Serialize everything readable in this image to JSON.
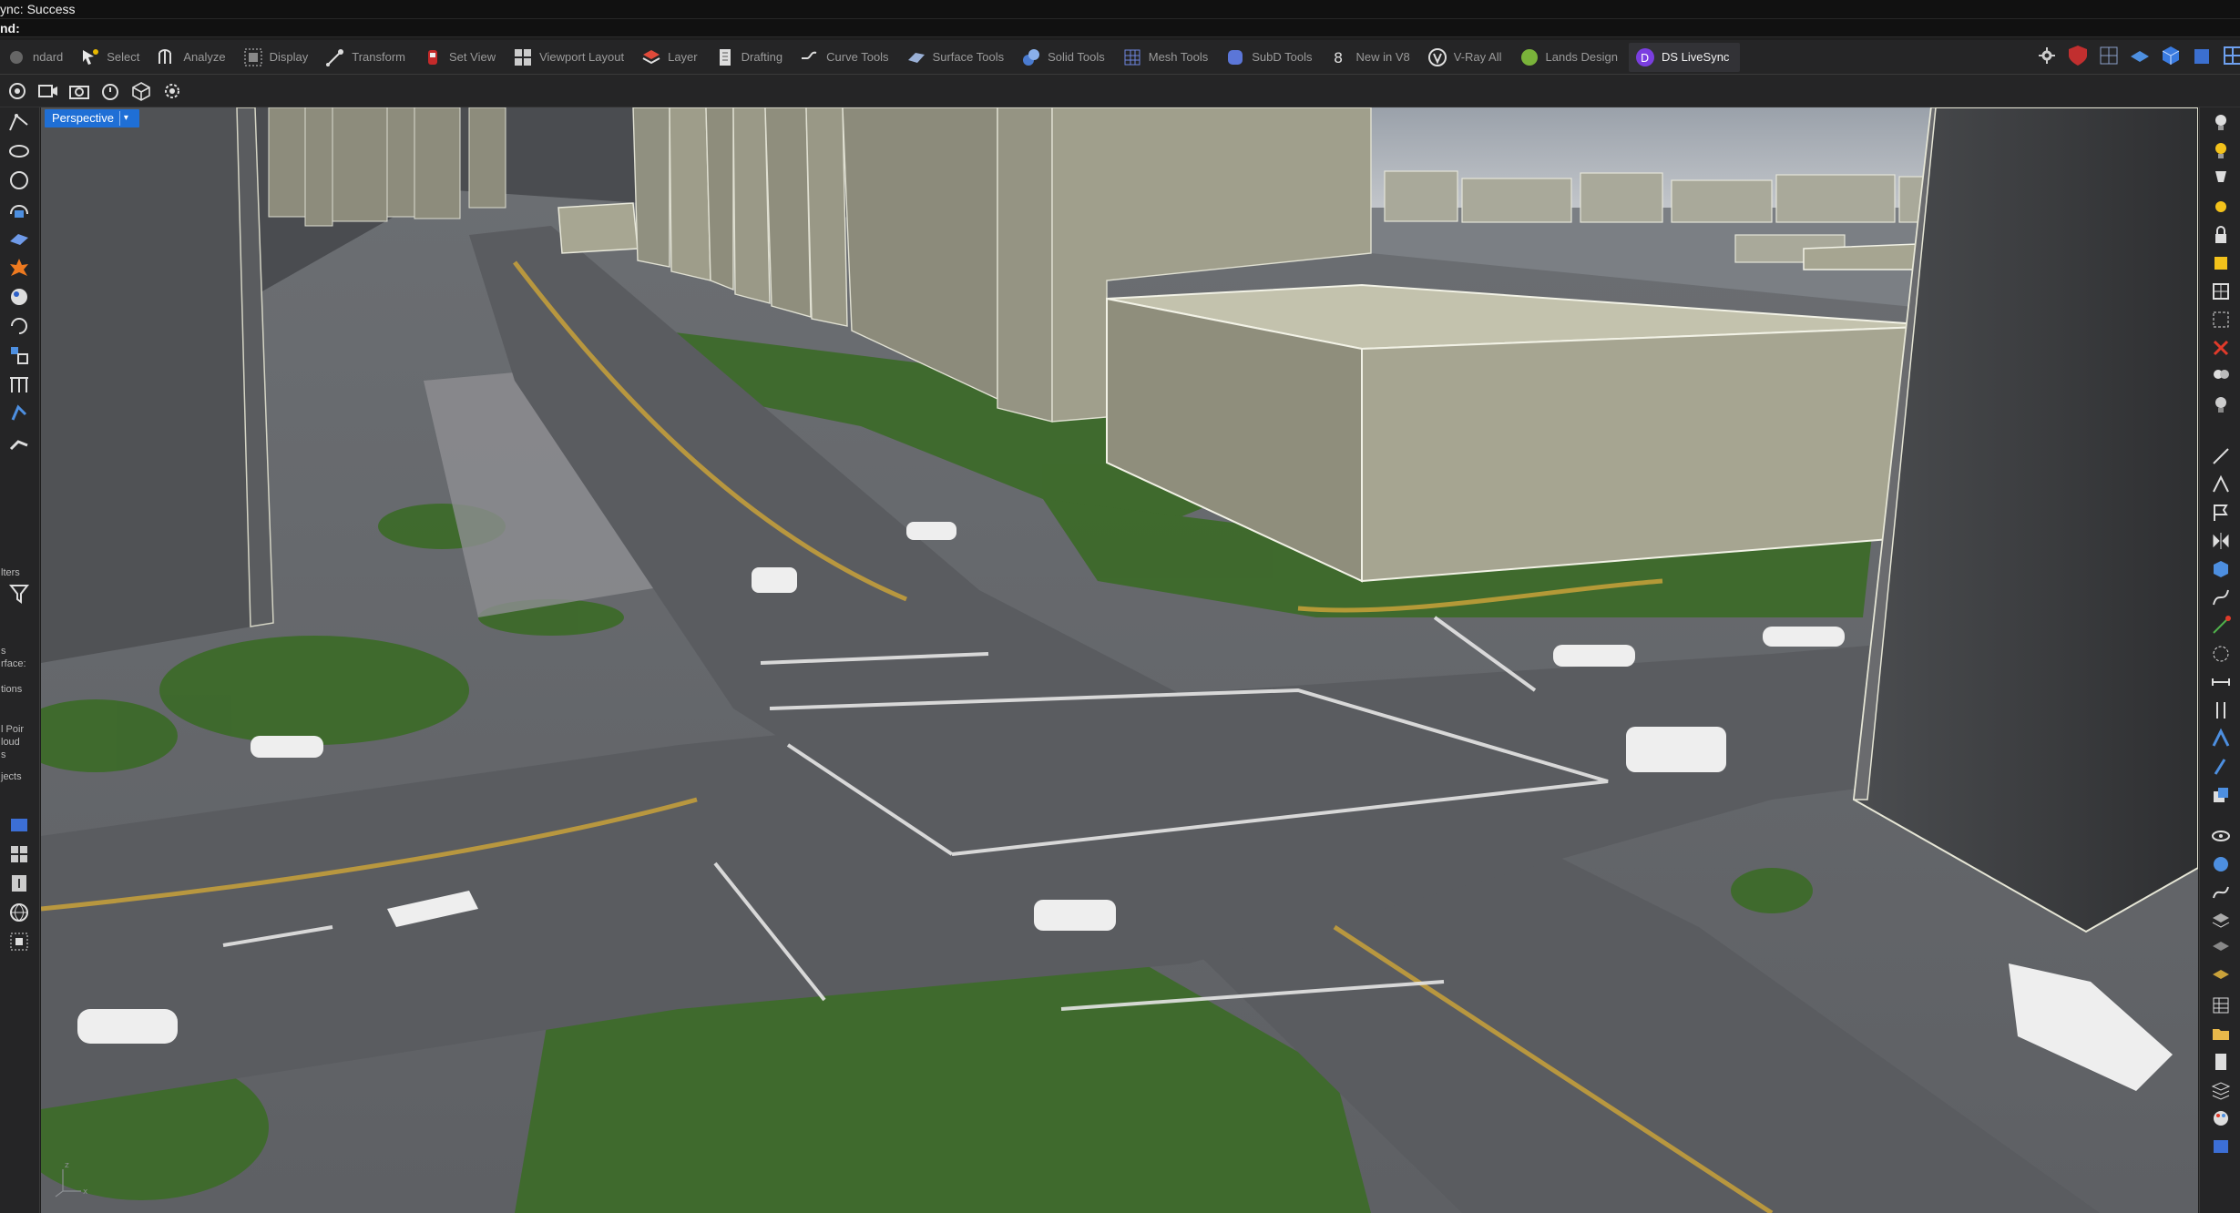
{
  "status_line": "ync: Success",
  "command_prompt": "nd:",
  "tabs": [
    {
      "label": "ndard",
      "icon": "standard-icon"
    },
    {
      "label": "Select",
      "icon": "select-icon"
    },
    {
      "label": "Analyze",
      "icon": "analyze-icon"
    },
    {
      "label": "Display",
      "icon": "display-icon"
    },
    {
      "label": "Transform",
      "icon": "transform-icon"
    },
    {
      "label": "Set View",
      "icon": "set-view-icon"
    },
    {
      "label": "Viewport Layout",
      "icon": "viewport-layout-icon"
    },
    {
      "label": "Layer",
      "icon": "layer-icon"
    },
    {
      "label": "Drafting",
      "icon": "drafting-icon"
    },
    {
      "label": "Curve Tools",
      "icon": "curve-tools-icon"
    },
    {
      "label": "Surface Tools",
      "icon": "surface-tools-icon"
    },
    {
      "label": "Solid Tools",
      "icon": "solid-tools-icon"
    },
    {
      "label": "Mesh Tools",
      "icon": "mesh-tools-icon"
    },
    {
      "label": "SubD Tools",
      "icon": "subd-tools-icon"
    },
    {
      "label": "New in V8",
      "icon": "new-in-v8-icon"
    },
    {
      "label": "V-Ray All",
      "icon": "vray-icon"
    },
    {
      "label": "Lands Design",
      "icon": "lands-design-icon"
    },
    {
      "label": "DS LiveSync",
      "icon": "ds-livesync-icon"
    }
  ],
  "active_tab": "DS LiveSync",
  "viewport": {
    "name": "Perspective",
    "dropdown_glyph": "▾"
  },
  "left_panel_texts": [
    "lters",
    "s",
    "rface:",
    "tions",
    "l Poir",
    "loud",
    "s",
    "jects"
  ],
  "axis": {
    "x": "x",
    "z": "z"
  },
  "colors": {
    "accent": "#1f6fd6",
    "building": "#a6a591",
    "building_dark": "#55575a",
    "sky": "#b8bec4",
    "road": "#6f7278",
    "grass": "#3f6a2c"
  }
}
